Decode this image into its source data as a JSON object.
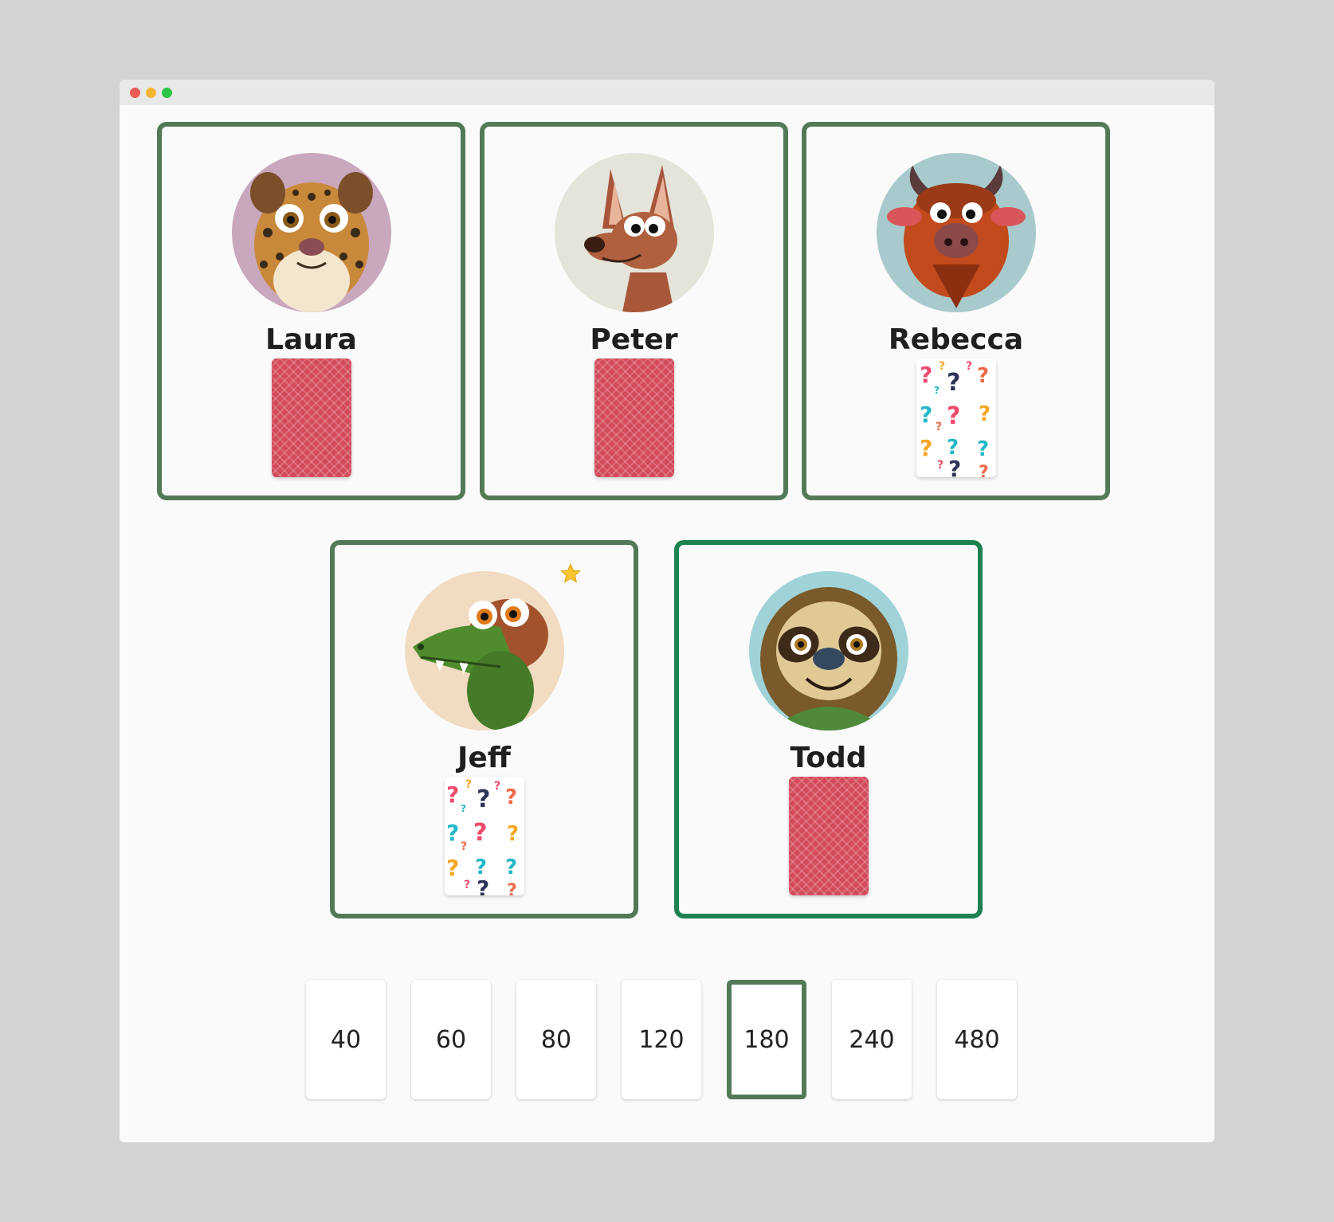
{
  "window": {
    "controls": [
      "close-dot",
      "minimize-dot",
      "maximize-dot"
    ],
    "control_colors": {
      "close": "#ee5d55",
      "minimize": "#f5b533",
      "maximize": "#2cc444"
    }
  },
  "colors": {
    "player_border": "#527a57",
    "active_player_border": "#1e8150",
    "card_back": "#d34a5a",
    "selected_vote_border": "#527a57"
  },
  "players": [
    {
      "name": "Laura",
      "avatar": "leopard-avatar",
      "card": "face-down",
      "active": false,
      "star": false
    },
    {
      "name": "Peter",
      "avatar": "kangaroo-avatar",
      "card": "face-down",
      "active": false,
      "star": false
    },
    {
      "name": "Rebecca",
      "avatar": "bison-avatar",
      "card": "question-marks",
      "active": false,
      "star": false
    },
    {
      "name": "Jeff",
      "avatar": "crocodile-avatar",
      "card": "question-marks",
      "active": false,
      "star": true
    },
    {
      "name": "Todd",
      "avatar": "sloth-avatar",
      "card": "face-down",
      "active": true,
      "star": false
    }
  ],
  "votes": {
    "options": [
      "40",
      "60",
      "80",
      "120",
      "180",
      "240",
      "480"
    ],
    "selected": "180"
  }
}
